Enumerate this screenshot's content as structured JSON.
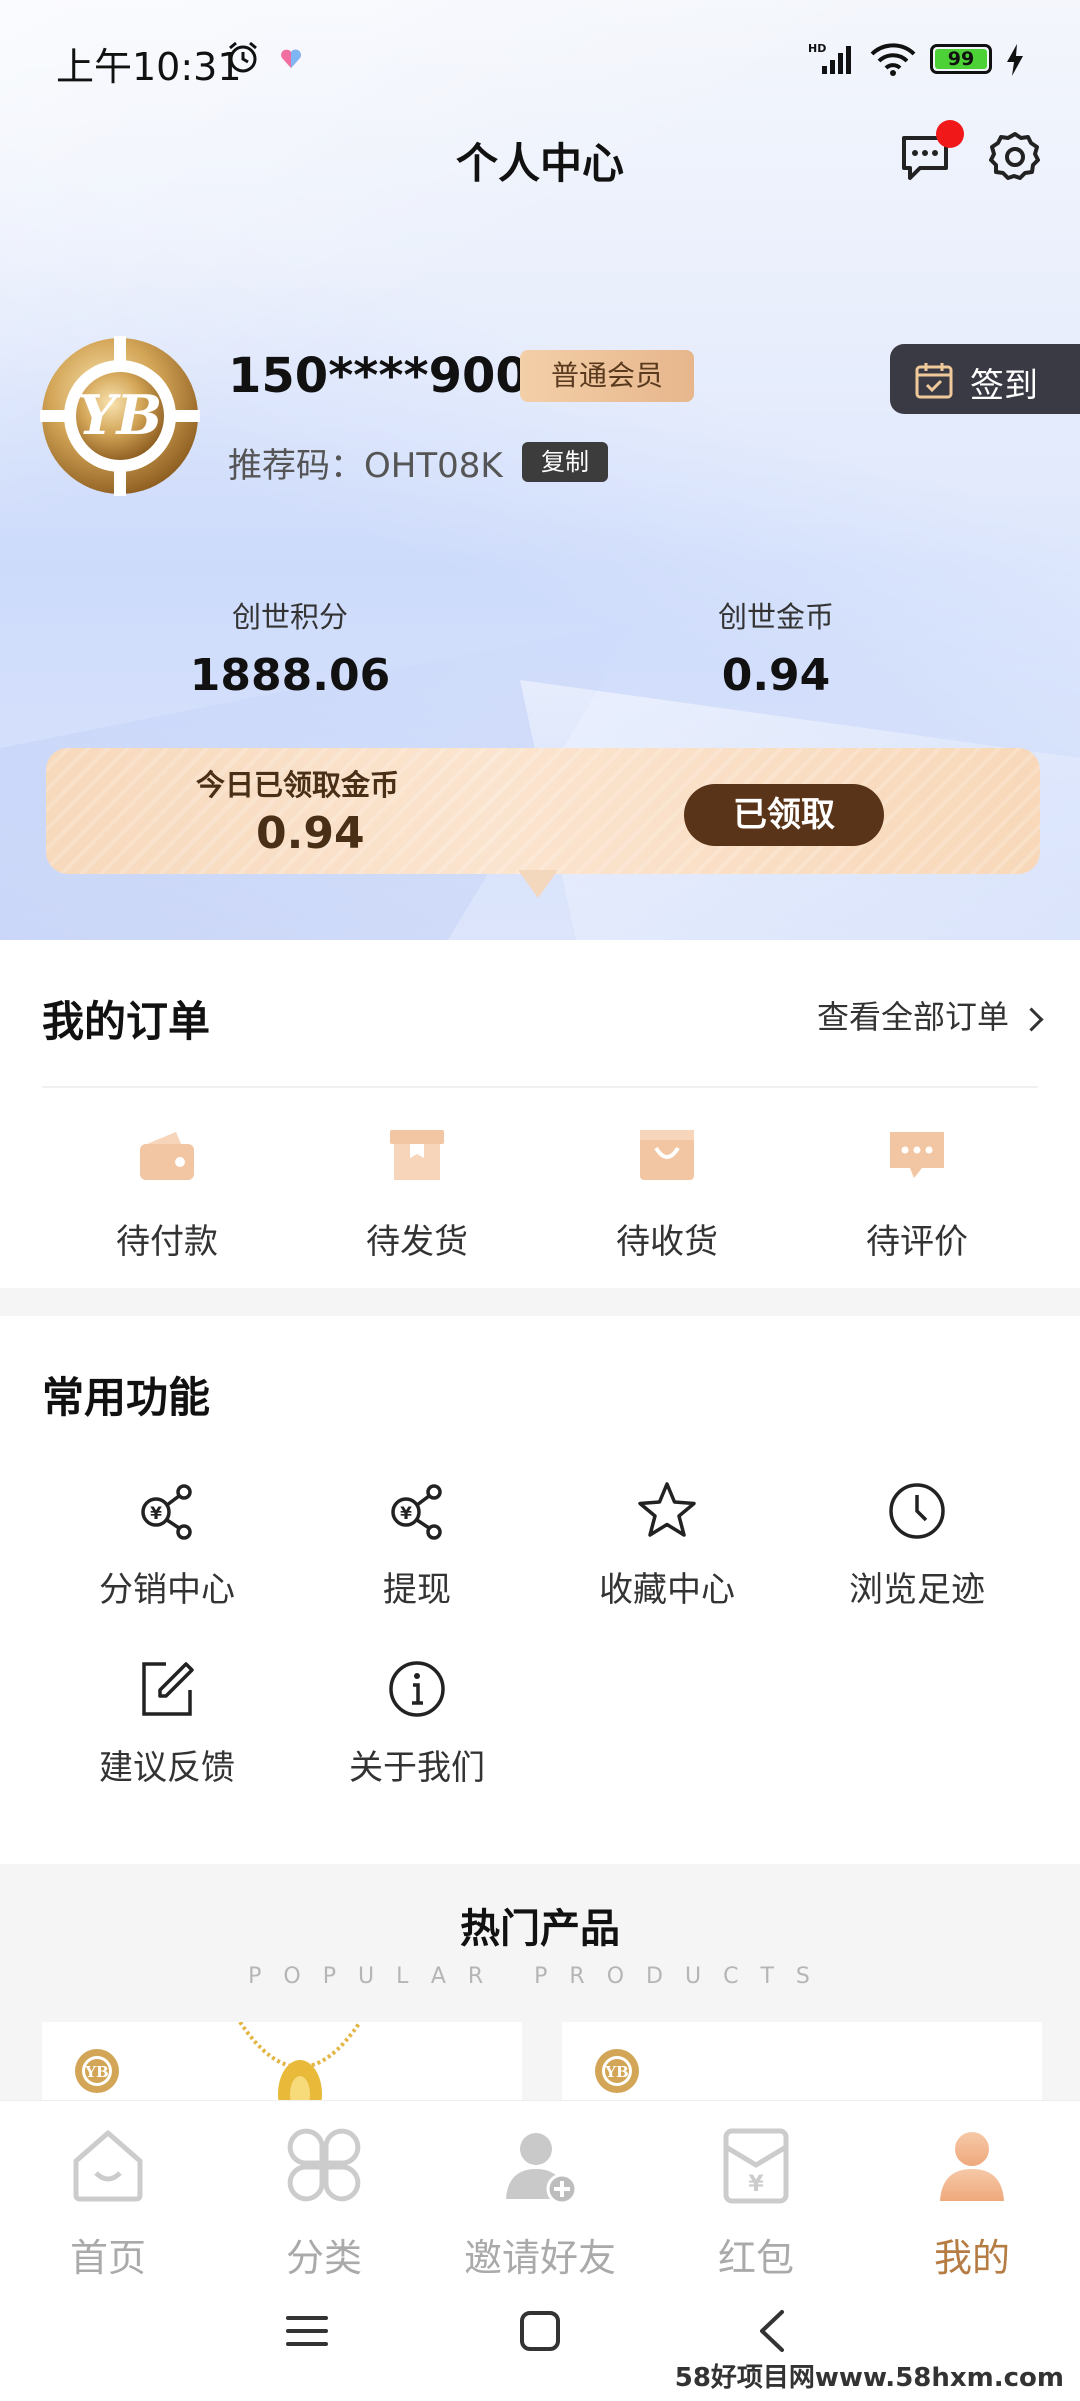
{
  "status_bar": {
    "time": "上午10:31",
    "battery": "99"
  },
  "header": {
    "title": "个人中心"
  },
  "profile": {
    "phone": "150****9006",
    "member_level": "普通会员",
    "referral_code": "推荐码：OHT08K",
    "copy_label": "复制",
    "signin_label": "签到"
  },
  "stats": {
    "points_label": "创世积分",
    "points_value": "1888.06",
    "coins_label": "创世金币",
    "coins_value": "0.94"
  },
  "daily_gold": {
    "label": "今日已领取金币",
    "value": "0.94",
    "button_label": "已领取"
  },
  "orders": {
    "title": "我的订单",
    "view_all": "查看全部订单",
    "items": [
      {
        "label": "待付款",
        "icon": "wallet-icon"
      },
      {
        "label": "待发货",
        "icon": "package-icon"
      },
      {
        "label": "待收货",
        "icon": "bag-icon"
      },
      {
        "label": "待评价",
        "icon": "comment-icon"
      }
    ]
  },
  "functions": {
    "title": "常用功能",
    "items": [
      {
        "label": "分销中心",
        "icon": "distribution-icon"
      },
      {
        "label": "提现",
        "icon": "withdraw-icon"
      },
      {
        "label": "收藏中心",
        "icon": "star-icon"
      },
      {
        "label": "浏览足迹",
        "icon": "clock-icon"
      },
      {
        "label": "建议反馈",
        "icon": "edit-icon"
      },
      {
        "label": "关于我们",
        "icon": "info-icon"
      }
    ]
  },
  "hot_products": {
    "title": "热门产品",
    "subtitle": "POPULAR PRODUCTS"
  },
  "tabbar": {
    "items": [
      {
        "label": "首页",
        "icon": "home-icon"
      },
      {
        "label": "分类",
        "icon": "category-icon"
      },
      {
        "label": "邀请好友",
        "icon": "invite-friend-icon"
      },
      {
        "label": "红包",
        "icon": "red-packet-icon"
      },
      {
        "label": "我的",
        "icon": "profile-icon"
      }
    ],
    "active": "我的"
  },
  "watermark": "58好项目网www.58hxm.com",
  "colors": {
    "accent_gold": "#b57d44",
    "dark_brown": "#5a3418",
    "badge_red": "#f01818"
  }
}
